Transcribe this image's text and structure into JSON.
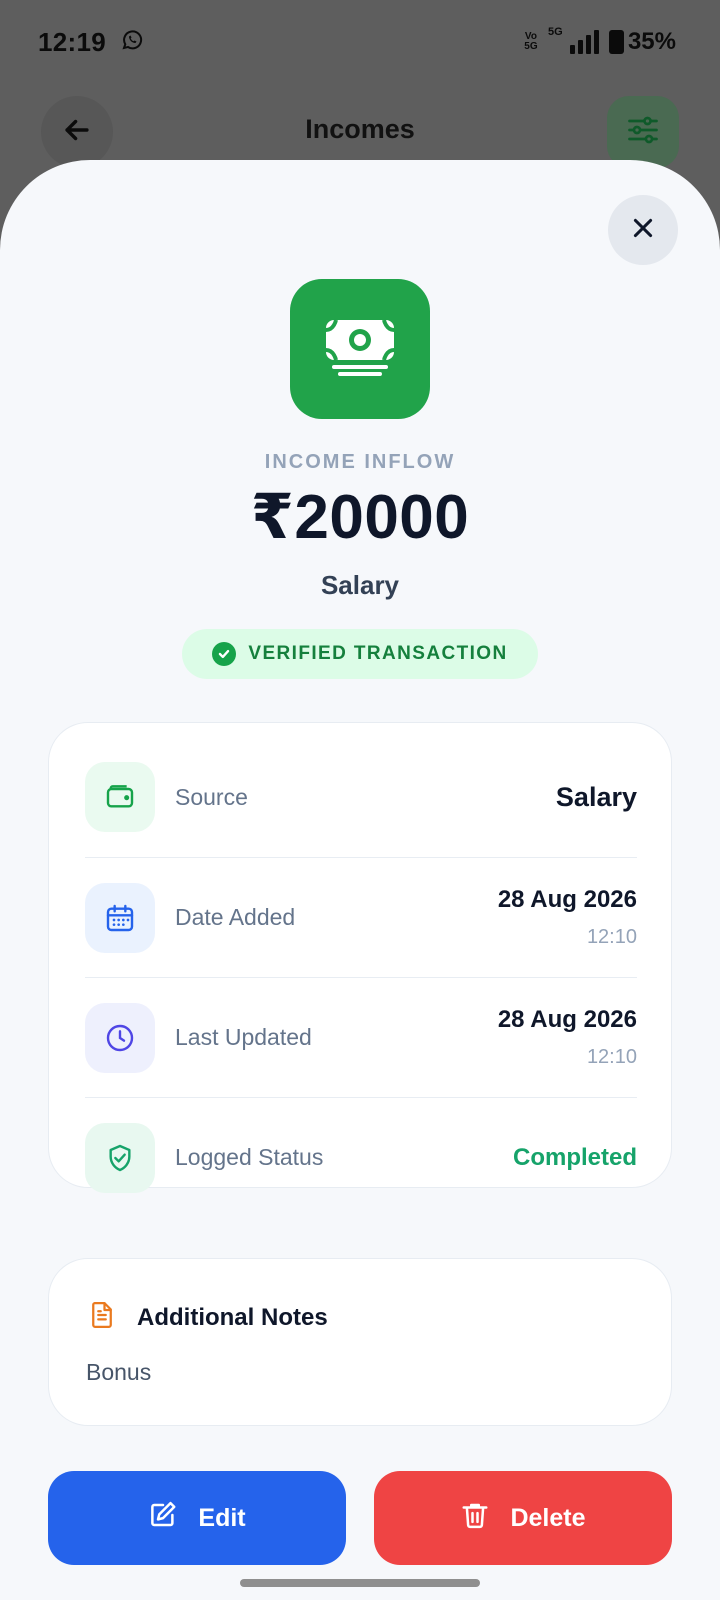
{
  "status_bar": {
    "time": "12:19",
    "volte_top": "Vo",
    "volte_bottom": "5G",
    "network": "5G",
    "battery": "35%"
  },
  "header": {
    "title": "Incomes",
    "back_icon": "arrow-left-icon",
    "filter_icon": "sliders-icon"
  },
  "sheet": {
    "inflow_label": "INCOME INFLOW",
    "amount": "₹20000",
    "category": "Salary",
    "badge": "VERIFIED TRANSACTION",
    "details": [
      {
        "label": "Source",
        "value": "Salary",
        "icon": "wallet-icon"
      },
      {
        "label": "Date Added",
        "value": "28 Aug 2026",
        "time": "12:10",
        "icon": "calendar-icon"
      },
      {
        "label": "Last Updated",
        "value": "28 Aug 2026",
        "time": "12:10",
        "icon": "clock-icon"
      },
      {
        "label": "Logged Status",
        "value": "Completed",
        "icon": "shield-check-icon"
      }
    ],
    "notes": {
      "title": "Additional Notes",
      "body": "Bonus"
    },
    "actions": {
      "edit": "Edit",
      "delete": "Delete"
    }
  },
  "colors": {
    "accent_green": "#21a34a",
    "edit_blue": "#2563eb",
    "delete_red": "#ef4444",
    "status_completed": "#16a36a"
  }
}
